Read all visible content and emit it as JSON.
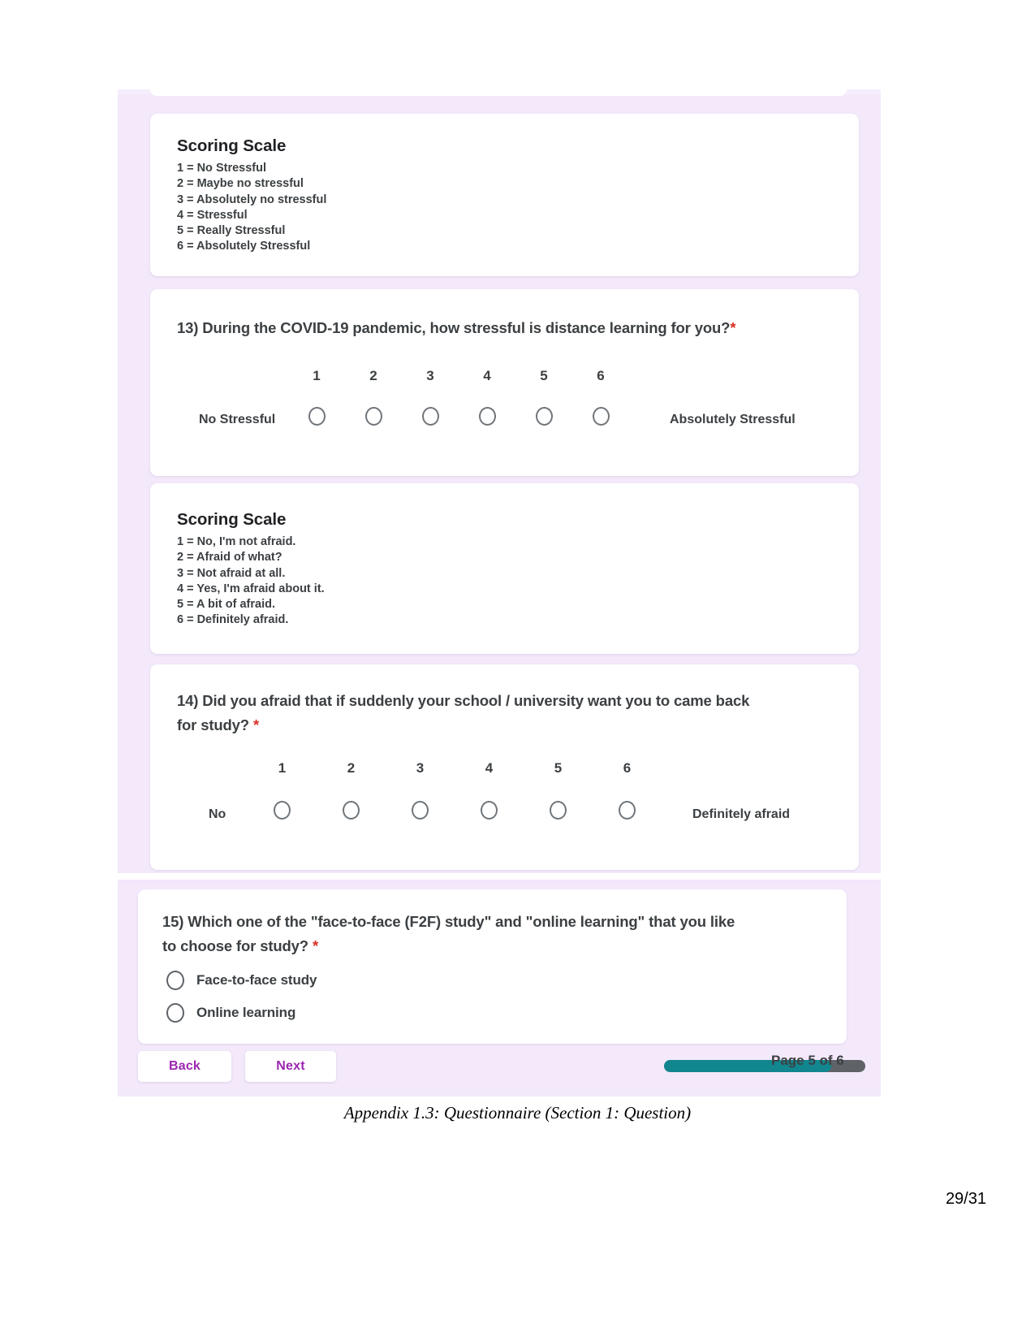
{
  "document": {
    "caption": "Appendix 1.3: Questionnaire (Section 1: Question)",
    "page_number": "29/31"
  },
  "form": {
    "scoring_scale_1": {
      "title": "Scoring Scale",
      "lines": [
        "1 = No Stressful",
        "2 = Maybe no stressful",
        "3 = Absolutely no stressful",
        "4 = Stressful",
        "5 = Really Stressful",
        "6 = Absolutely Stressful"
      ]
    },
    "question_13": {
      "text": "13) During the COVID-19 pandemic, how stressful is distance learning for you?",
      "required_marker": "*",
      "scale_numbers": [
        "1",
        "2",
        "3",
        "4",
        "5",
        "6"
      ],
      "left_label": "No Stressful",
      "right_label": "Absolutely Stressful"
    },
    "scoring_scale_2": {
      "title": "Scoring Scale",
      "lines": [
        "1 = No, I'm not afraid.",
        "2 = Afraid of what?",
        "3 = Not afraid at all.",
        "4 = Yes, I'm afraid about it.",
        "5 = A bit of afraid.",
        "6 = Definitely afraid."
      ]
    },
    "question_14": {
      "text_line_1": "14) Did you afraid that if suddenly your school / university want you to came back",
      "text_line_2": "for study?",
      "required_marker": "*",
      "scale_numbers": [
        "1",
        "2",
        "3",
        "4",
        "5",
        "6"
      ],
      "left_label": "No",
      "right_label": "Definitely afraid"
    },
    "question_15": {
      "text_line_1": "15) Which one of the \"face-to-face (F2F) study\" and \"online learning\" that you like",
      "text_line_2": "to choose for study?",
      "required_marker": "*",
      "options": [
        "Face-to-face study",
        "Online learning"
      ]
    },
    "footer": {
      "back_label": "Back",
      "next_label": "Next",
      "page_indicator": "Page 5 of 6",
      "progress_percent": 83,
      "progress_fill_color": "#11868f",
      "progress_track_color": "#5f6368",
      "button_text_color": "#9c27b0"
    }
  }
}
